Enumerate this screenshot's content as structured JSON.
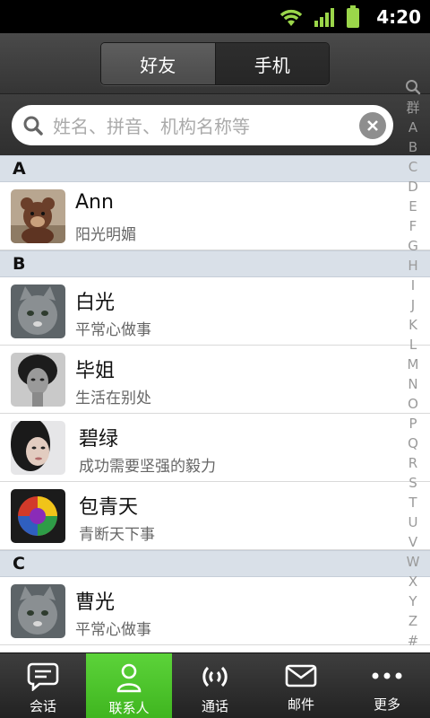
{
  "status_bar": {
    "time": "4:20"
  },
  "header": {
    "segments": [
      {
        "label": "好友",
        "active": true
      },
      {
        "label": "手机",
        "active": false
      }
    ]
  },
  "search": {
    "placeholder": "姓名、拼音、机构名称等"
  },
  "sections": [
    {
      "letter": "A",
      "contacts": [
        {
          "name": "Ann",
          "signature": "阳光明媚",
          "avatar": "teddy-bear-photo"
        }
      ]
    },
    {
      "letter": "B",
      "contacts": [
        {
          "name": "白光",
          "signature": "平常心做事",
          "avatar": "kitten-photo"
        },
        {
          "name": "毕姐",
          "signature": "生活在别处",
          "avatar": "woman-bw-photo"
        },
        {
          "name": "碧绿",
          "signature": "成功需要坚强的毅力",
          "avatar": "woman-portrait-photo"
        },
        {
          "name": "包青天",
          "signature": "青断天下事",
          "avatar": "rainbow-rose-photo"
        }
      ]
    },
    {
      "letter": "C",
      "contacts": [
        {
          "name": "曹光",
          "signature": "平常心做事",
          "avatar": "kitten-photo"
        }
      ]
    }
  ],
  "index_letters": [
    "群",
    "A",
    "B",
    "C",
    "D",
    "E",
    "F",
    "G",
    "H",
    "I",
    "J",
    "K",
    "L",
    "M",
    "N",
    "O",
    "P",
    "Q",
    "R",
    "S",
    "T",
    "U",
    "V",
    "W",
    "X",
    "Y",
    "Z",
    "#"
  ],
  "tabs": [
    {
      "label": "会话",
      "icon": "chat-bubble-icon",
      "active": false
    },
    {
      "label": "联系人",
      "icon": "person-icon",
      "active": true
    },
    {
      "label": "通话",
      "icon": "phone-signal-icon",
      "active": false
    },
    {
      "label": "邮件",
      "icon": "envelope-icon",
      "active": false
    },
    {
      "label": "更多",
      "icon": "more-dots-icon",
      "active": false
    }
  ],
  "colors": {
    "accent": "#45bb25",
    "section_header": "#d9e0e8",
    "status_icons": "#8fd23b"
  }
}
